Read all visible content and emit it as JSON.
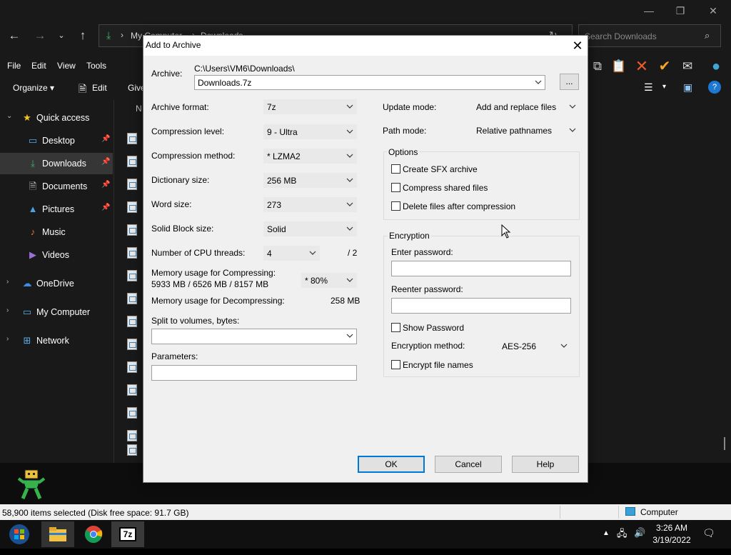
{
  "explorer": {
    "breadcrumb": [
      "My Computer",
      "Downloads"
    ],
    "search_placeholder": "Search Downloads",
    "menu": [
      "File",
      "Edit",
      "View",
      "Tools"
    ],
    "commands": {
      "organize": "Organize ▾",
      "edit": "Edit",
      "give": "Give"
    },
    "column_header": "N",
    "nav": {
      "quick_access": "Quick access",
      "desktop": "Desktop",
      "downloads": "Downloads",
      "documents": "Documents",
      "pictures": "Pictures",
      "music": "Music",
      "videos": "Videos",
      "onedrive": "OneDrive",
      "my_computer": "My Computer",
      "network": "Network"
    },
    "status": "58,900 items selected (Disk free space: 91.7 GB)",
    "status_right": "Computer"
  },
  "taskbar": {
    "time": "3:26 AM",
    "date": "3/19/2022",
    "app_7z": "7z"
  },
  "dialog": {
    "title": "Add to Archive",
    "archive_label": "Archive:",
    "archive_path": "C:\\Users\\VM6\\Downloads\\",
    "archive_name": "Downloads.7z",
    "browse_label": "...",
    "left": {
      "format_label": "Archive format:",
      "format_value": "7z",
      "level_label": "Compression level:",
      "level_value": "9 - Ultra",
      "method_label": "Compression method:",
      "method_value": "*  LZMA2",
      "dict_label": "Dictionary size:",
      "dict_value": "256 MB",
      "word_label": "Word size:",
      "word_value": "273",
      "solid_label": "Solid Block size:",
      "solid_value": "Solid",
      "threads_label": "Number of CPU threads:",
      "threads_value": "4",
      "threads_total": "/ 2",
      "mem_comp_label": "Memory usage for Compressing:",
      "mem_comp_values": "5933 MB / 6526 MB / 8157 MB",
      "mem_comp_pct": "* 80%",
      "mem_decomp_label": "Memory usage for Decompressing:",
      "mem_decomp_value": "258 MB",
      "split_label": "Split to volumes, bytes:",
      "split_value": "",
      "params_label": "Parameters:",
      "params_value": ""
    },
    "right": {
      "update_label": "Update mode:",
      "update_value": "Add and replace files",
      "path_label": "Path mode:",
      "path_value": "Relative pathnames",
      "options_title": "Options",
      "opt_sfx": "Create SFX archive",
      "opt_shared": "Compress shared files",
      "opt_delete": "Delete files after compression",
      "enc_title": "Encryption",
      "enter_pw_label": "Enter password:",
      "reenter_pw_label": "Reenter password:",
      "show_pw": "Show Password",
      "enc_method_label": "Encryption method:",
      "enc_method_value": "AES-256",
      "enc_names": "Encrypt file names"
    },
    "buttons": {
      "ok": "OK",
      "cancel": "Cancel",
      "help": "Help"
    }
  },
  "colors": {
    "accent": "#0078d7",
    "explorer_bg": "#191919",
    "dialog_bg": "#f0f0f0"
  }
}
